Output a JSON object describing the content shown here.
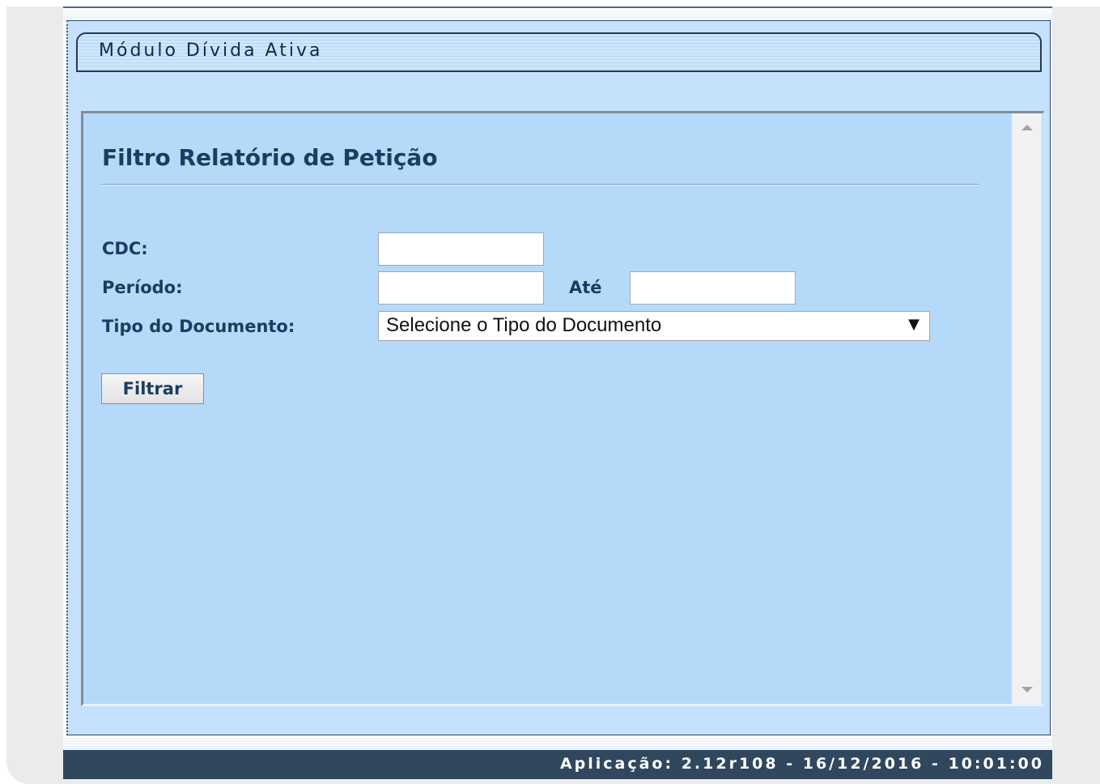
{
  "module": {
    "title": "Módulo Dívida Ativa"
  },
  "form": {
    "title": "Filtro Relatório de Petição",
    "cdc_label": "CDC:",
    "cdc_value": "",
    "periodo_label": "Período:",
    "periodo_from_value": "",
    "ate_label": "Até",
    "periodo_to_value": "",
    "tipo_label": "Tipo do Documento:",
    "tipo_selected": "Selecione o Tipo do Documento",
    "tipo_arrow": "▼",
    "filter_button": "Filtrar"
  },
  "footer": {
    "text": "Aplicação: 2.12r108 - 16/12/2016 - 10:01:00"
  },
  "colors": {
    "panel_bg": "#c6e1fb",
    "content_bg": "#b5daf9",
    "label_text": "#1c3c60",
    "footer_bg": "#30475e"
  },
  "icons": {
    "scroll_up": "scroll-up-arrow-icon",
    "scroll_down": "scroll-down-arrow-icon",
    "dropdown": "dropdown-arrow-icon"
  }
}
